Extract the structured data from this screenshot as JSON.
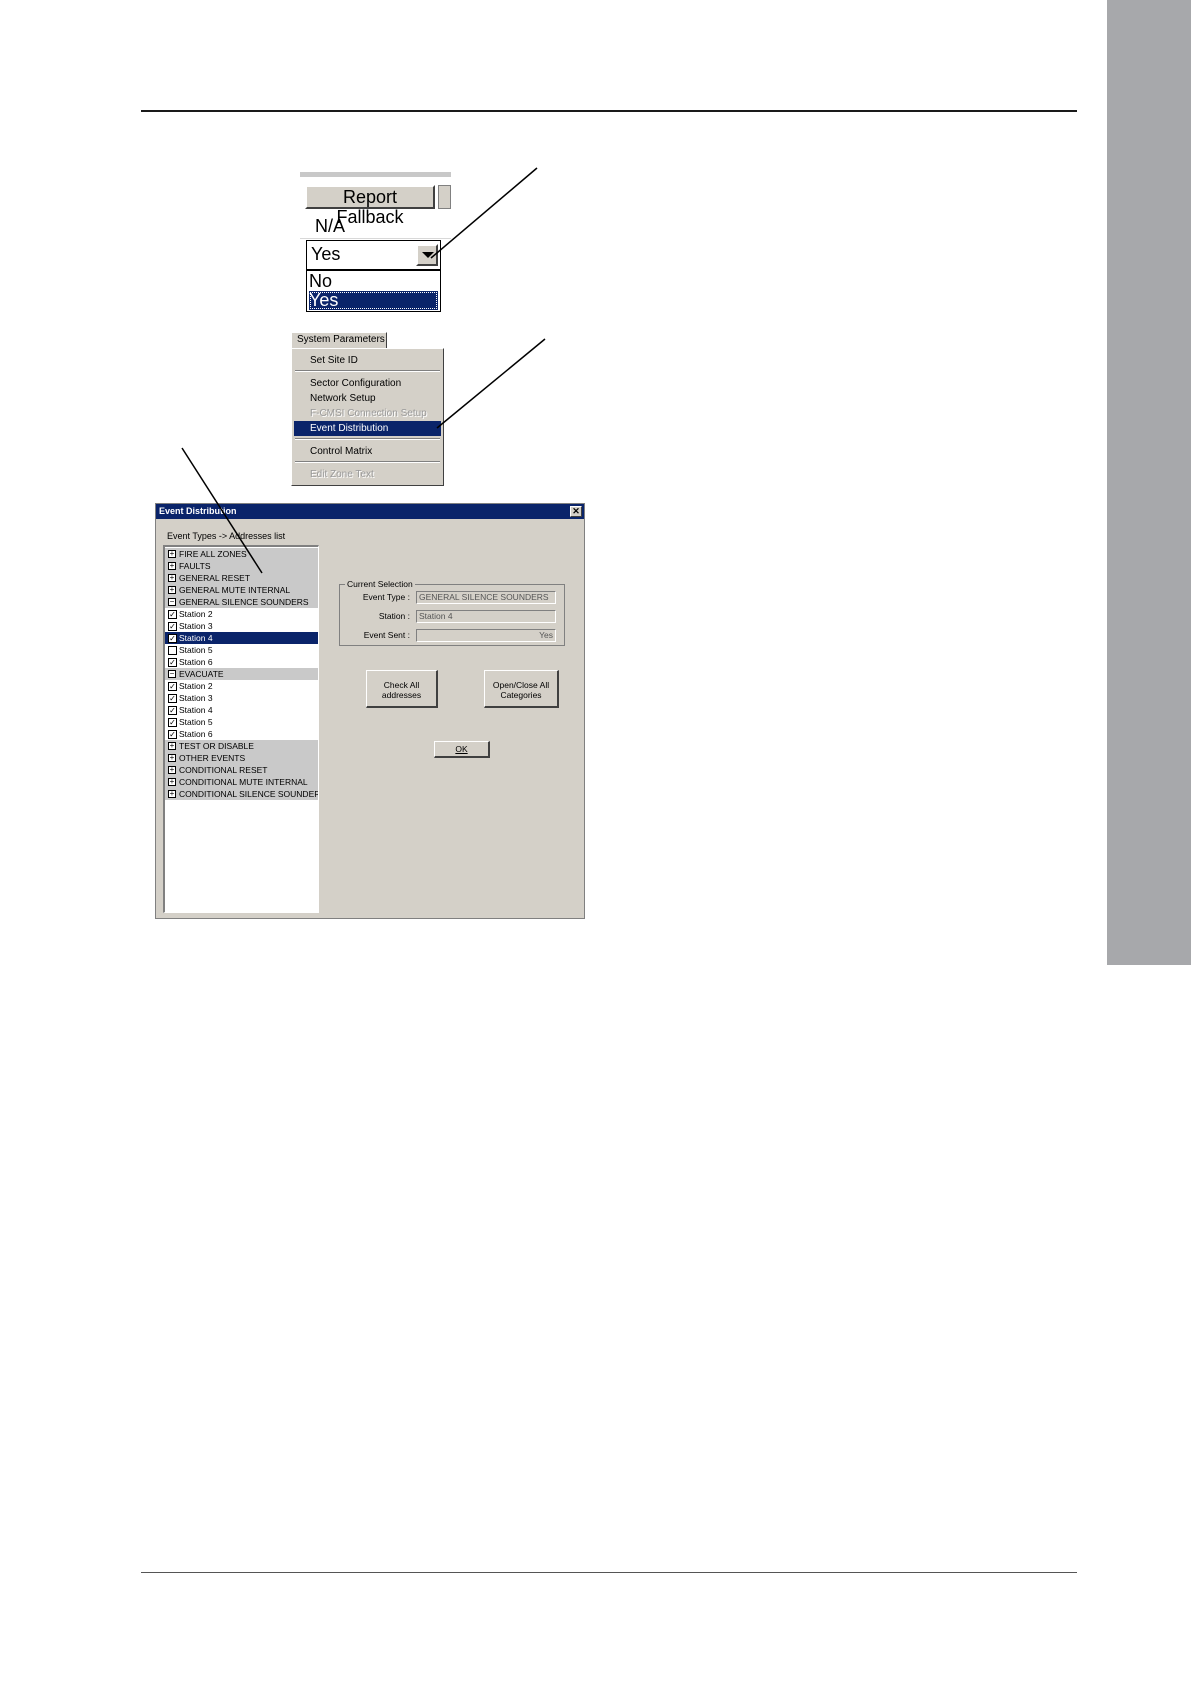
{
  "report_fallback": {
    "header": "Report Fallback",
    "row_value": "N/A",
    "combo_value": "Yes",
    "options": [
      "No",
      "Yes"
    ],
    "selected_option": "Yes"
  },
  "system_parameters_menu": {
    "menu_label": "System Parameters",
    "items": [
      {
        "label": "Set Site ID",
        "state": "normal"
      },
      {
        "label": "Sector Configuration",
        "state": "normal"
      },
      {
        "label": "Network Setup",
        "state": "normal"
      },
      {
        "label": "F-CMSI Connection Setup",
        "state": "disabled"
      },
      {
        "label": "Event Distribution",
        "state": "selected"
      },
      {
        "label": "Control Matrix",
        "state": "normal"
      },
      {
        "label": "Edit Zone Text",
        "state": "disabled"
      }
    ]
  },
  "event_distribution": {
    "title": "Event Distribution",
    "close_glyph": "✕",
    "tree_caption": "Event Types -> Addresses list",
    "tree": [
      {
        "kind": "category",
        "expander": "+",
        "label": "FIRE ALL ZONES"
      },
      {
        "kind": "category",
        "expander": "+",
        "label": "FAULTS"
      },
      {
        "kind": "category",
        "expander": "+",
        "label": "GENERAL RESET"
      },
      {
        "kind": "category",
        "expander": "+",
        "label": "GENERAL MUTE INTERNAL"
      },
      {
        "kind": "category",
        "expander": "−",
        "label": "GENERAL SILENCE SOUNDERS"
      },
      {
        "kind": "item",
        "checked": true,
        "label": "Station 2"
      },
      {
        "kind": "item",
        "checked": true,
        "label": "Station 3"
      },
      {
        "kind": "item",
        "checked": true,
        "label": "Station 4",
        "selected": true
      },
      {
        "kind": "item",
        "checked": false,
        "label": "Station 5"
      },
      {
        "kind": "item",
        "checked": true,
        "label": "Station 6"
      },
      {
        "kind": "category",
        "expander": "−",
        "label": "EVACUATE"
      },
      {
        "kind": "item",
        "checked": true,
        "label": "Station 2"
      },
      {
        "kind": "item",
        "checked": true,
        "label": "Station 3"
      },
      {
        "kind": "item",
        "checked": true,
        "label": "Station 4"
      },
      {
        "kind": "item",
        "checked": true,
        "label": "Station 5"
      },
      {
        "kind": "item",
        "checked": true,
        "label": "Station 6"
      },
      {
        "kind": "category",
        "expander": "+",
        "label": "TEST OR DISABLE"
      },
      {
        "kind": "category",
        "expander": "+",
        "label": "OTHER EVENTS"
      },
      {
        "kind": "category",
        "expander": "+",
        "label": "CONDITIONAL RESET"
      },
      {
        "kind": "category",
        "expander": "+",
        "label": "CONDITIONAL MUTE INTERNAL"
      },
      {
        "kind": "category",
        "expander": "+",
        "label": "CONDITIONAL SILENCE SOUNDERS"
      }
    ],
    "current_selection": {
      "legend": "Current Selection",
      "event_type_label": "Event Type :",
      "event_type_value": "GENERAL SILENCE SOUNDERS",
      "station_label": "Station :",
      "station_value": "Station 4",
      "event_sent_label": "Event Sent :",
      "event_sent_value": "Yes"
    },
    "buttons": {
      "check_all": "Check All addresses",
      "open_close_all": "Open/Close All Categories",
      "ok": "OK"
    }
  },
  "colors": {
    "side_tab": "#a7a8ab",
    "selection": "#0a246a",
    "dialog_face": "#d4d0c8"
  }
}
